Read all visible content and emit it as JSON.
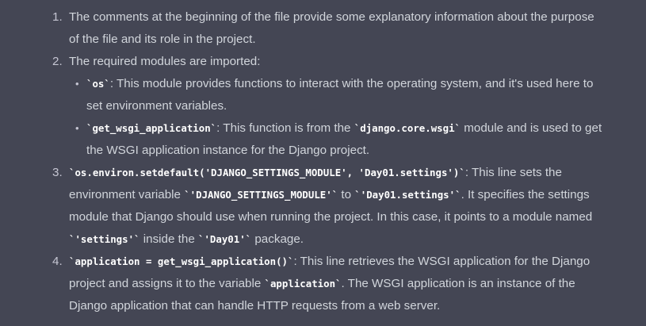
{
  "items": [
    {
      "number": "1.",
      "text": "The comments at the beginning of the file provide some explanatory information about the purpose of the file and its role in the project."
    },
    {
      "number": "2.",
      "text": "The required modules are imported:",
      "subitems": [
        {
          "code": "`os`",
          "text": ": This module provides functions to interact with the operating system, and it's used here to set environment variables."
        },
        {
          "code": "`get_wsgi_application`",
          "text1": ": This function is from the ",
          "code2": "`django.core.wsgi`",
          "text2": " module and is used to get the WSGI application instance for the Django project."
        }
      ]
    },
    {
      "number": "3.",
      "code": "`os.environ.setdefault('DJANGO_SETTINGS_MODULE', 'Day01.settings')`",
      "text1": ": This line sets the environment variable ",
      "code2": "`'DJANGO_SETTINGS_MODULE'`",
      "text2": " to ",
      "code3": "`'Day01.settings'`",
      "text3": ". It specifies the settings module that Django should use when running the project. In this case, it points to a module named ",
      "code4": "`'settings'`",
      "text4": " inside the ",
      "code5": "`'Day01'`",
      "text5": " package."
    },
    {
      "number": "4.",
      "code": "`application = get_wsgi_application()`",
      "text1": ": This line retrieves the WSGI application for the Django project and assigns it to the variable ",
      "code2": "`application`",
      "text2": ". The WSGI application is an instance of the Django application that can handle HTTP requests from a web server."
    }
  ]
}
